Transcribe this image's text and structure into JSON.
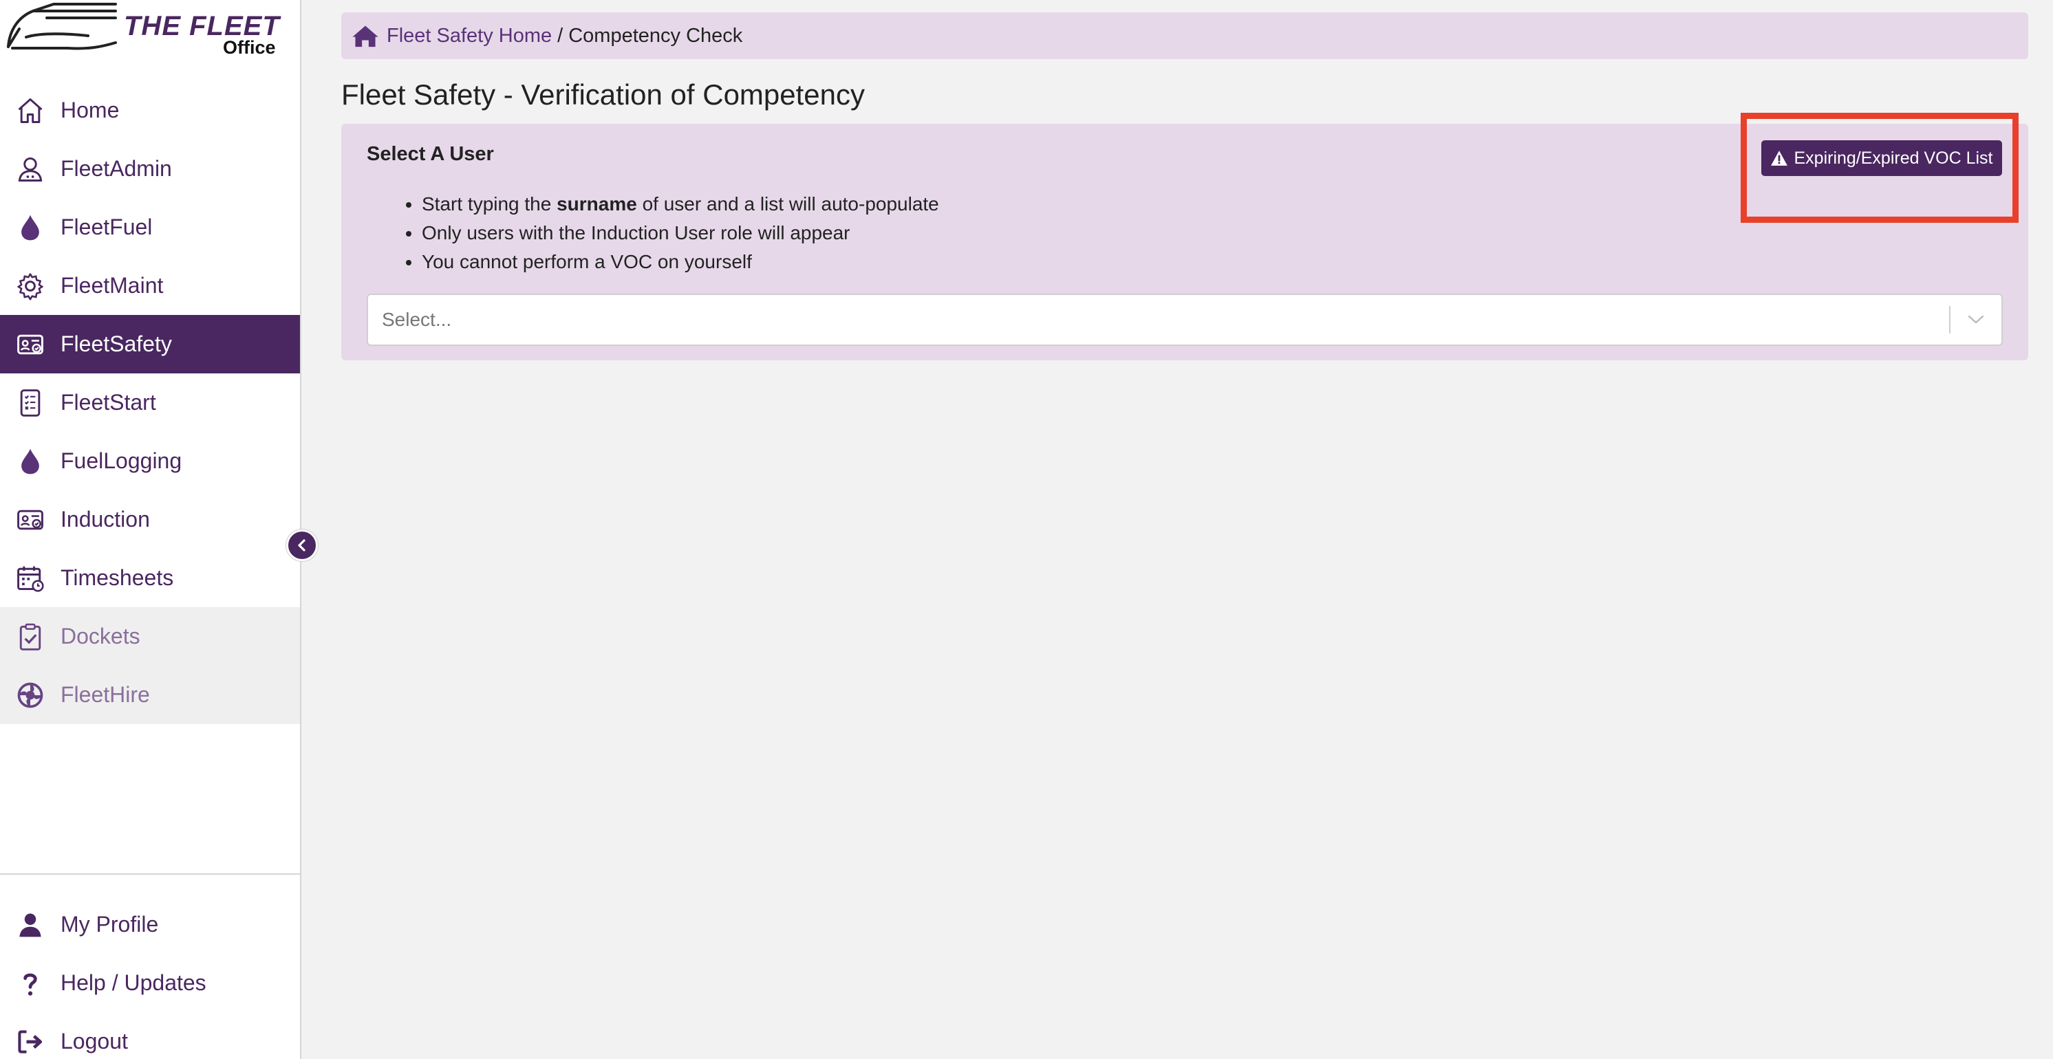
{
  "logo": {
    "brand": "THE FLEET",
    "sub": "Office"
  },
  "sidebar": {
    "items": [
      {
        "label": "Home",
        "icon": "home-icon"
      },
      {
        "label": "FleetAdmin",
        "icon": "user-admin-icon"
      },
      {
        "label": "FleetFuel",
        "icon": "fuel-drop-icon"
      },
      {
        "label": "FleetMaint",
        "icon": "gear-icon"
      },
      {
        "label": "FleetSafety",
        "icon": "id-card-icon",
        "active": true
      },
      {
        "label": "FleetStart",
        "icon": "checklist-phone-icon"
      },
      {
        "label": "FuelLogging",
        "icon": "fuel-drop-icon"
      },
      {
        "label": "Induction",
        "icon": "id-card-icon"
      },
      {
        "label": "Timesheets",
        "icon": "calendar-icon"
      },
      {
        "label": "Dockets",
        "icon": "clipboard-check-icon",
        "disabled": true
      },
      {
        "label": "FleetHire",
        "icon": "hire-wheel-icon",
        "disabled": true
      }
    ],
    "bottom": [
      {
        "label": "My Profile",
        "icon": "user-icon"
      },
      {
        "label": "Help / Updates",
        "icon": "question-icon"
      },
      {
        "label": "Logout",
        "icon": "logout-icon"
      }
    ]
  },
  "breadcrumb": {
    "home_link": "Fleet Safety Home",
    "separator": "/",
    "current": "Competency Check"
  },
  "page": {
    "title": "Fleet Safety - Verification of Competency"
  },
  "card": {
    "title": "Select A User",
    "bullets": {
      "b1_pre": "Start typing the ",
      "b1_bold": "surname",
      "b1_post": " of user and a list will auto-populate",
      "b2": "Only users with the Induction User role will appear",
      "b3": "You cannot perform a VOC on yourself"
    },
    "select_placeholder": "Select..."
  },
  "voc_button": {
    "label": "Expiring/Expired VOC List"
  },
  "colors": {
    "brand": "#4a2760",
    "panel": "#e6d8e9",
    "highlight": "#e8402a",
    "background": "#f2f2f2"
  }
}
